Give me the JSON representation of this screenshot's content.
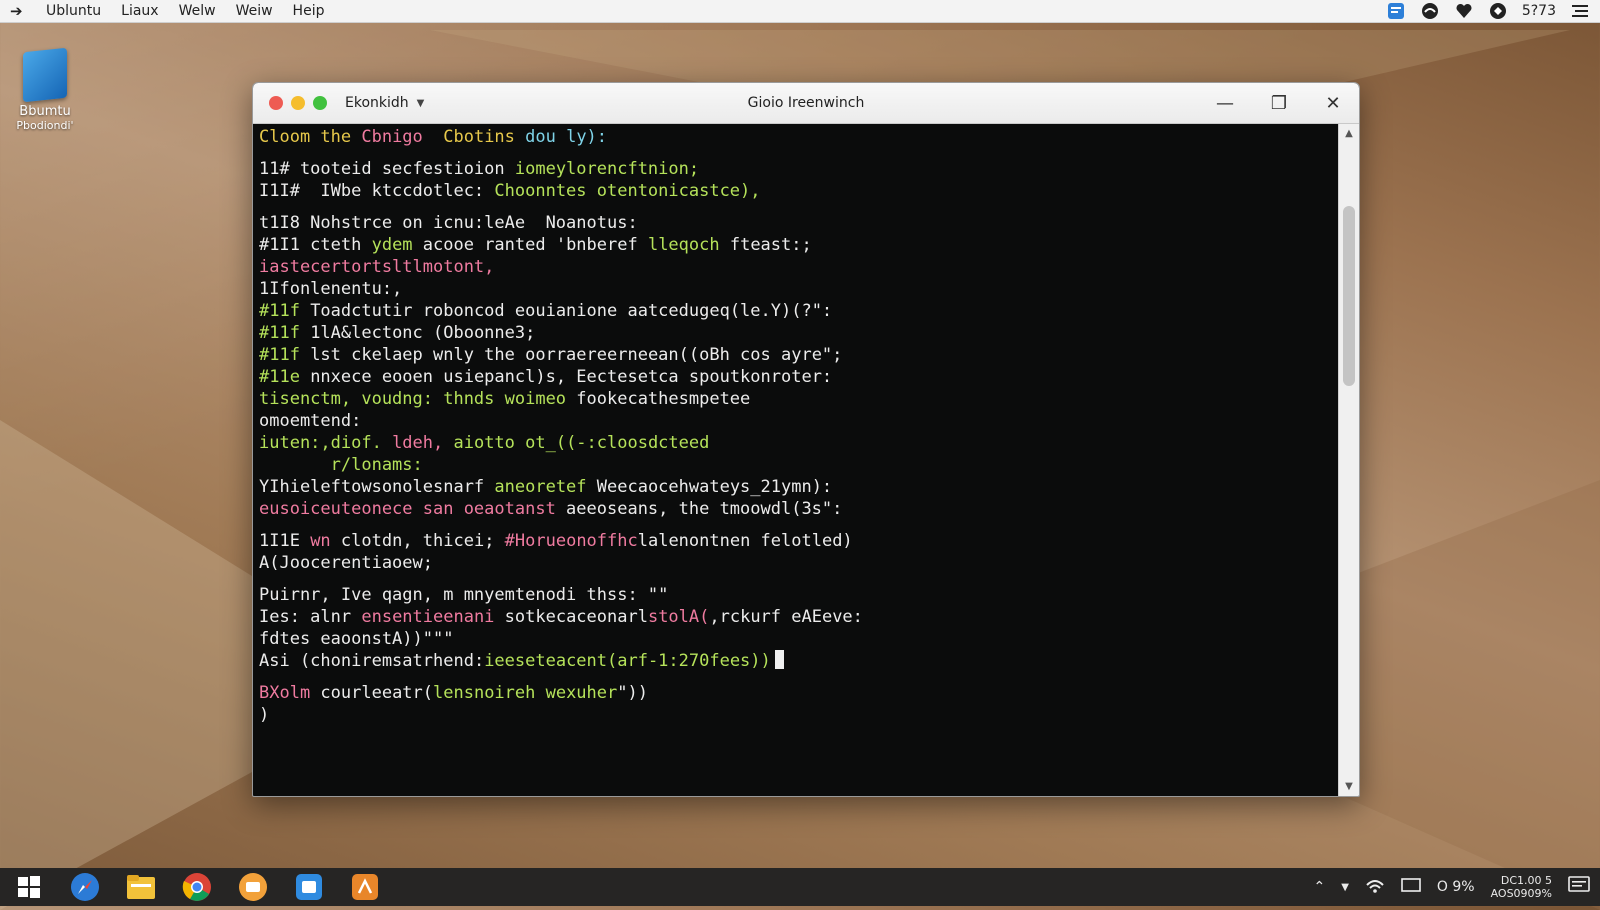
{
  "menubar": {
    "items": [
      "Ubluntu",
      "Liaux",
      "Welw",
      "Weiw",
      "Heip"
    ],
    "status": "5?73"
  },
  "desktop": {
    "icon_label": "Bbumtu",
    "icon_sublabel": "Pbodiondi'"
  },
  "window": {
    "tab_label": "Ekonkidh",
    "title": "Gioio Ireenwinch"
  },
  "terminal": {
    "lines": [
      [
        [
          "Cloom the ",
          "c-yellow"
        ],
        [
          "Cbnigo",
          "c-pink"
        ],
        [
          "  Cbotins",
          "c-yellow"
        ],
        [
          " dou ly):",
          "c-cyan"
        ]
      ],
      [],
      [
        [
          "11# tooteid secfestioion ",
          "c-white"
        ],
        [
          "iomeylorencftnion;",
          "c-green"
        ]
      ],
      [
        [
          "I1I#  IWbe ktccdotlec: ",
          "c-white"
        ],
        [
          "Choonntes otentonicastce),",
          "c-green"
        ]
      ],
      [],
      [
        [
          "t1I8 Nohstrce on icnu:leAe  Noanotus:",
          "c-white"
        ]
      ],
      [
        [
          "#1I1 cteth ",
          "c-white"
        ],
        [
          "ydem",
          "c-green"
        ],
        [
          " acooe ranted 'bnberef ",
          "c-white"
        ],
        [
          "lleqoch",
          "c-green"
        ],
        [
          " fteast:;",
          "c-white"
        ]
      ],
      [
        [
          "iastecertortsltlmotont,",
          "c-pink"
        ]
      ],
      [
        [
          "1Ifonlenentu:,",
          "c-white"
        ]
      ],
      [
        [
          "#11f",
          "c-green"
        ],
        [
          " Toadctutir roboncod eouianione aatcedugeq(le.Y)(?\":",
          "c-white"
        ]
      ],
      [
        [
          "#11f",
          "c-green"
        ],
        [
          " 1lA&lectonc (Oboonne3;",
          "c-white"
        ]
      ],
      [
        [
          "#11f",
          "c-green"
        ],
        [
          " lst ckelaep wnly the oorraereerneean((oBh cos ayre\";",
          "c-white"
        ]
      ],
      [
        [
          "#11e",
          "c-green"
        ],
        [
          " nnxece eooen usiepancl)s, Eectesetca spoutkonroter:",
          "c-white"
        ]
      ],
      [
        [
          "tisenctm, voudng: thnds woimeo",
          "c-green"
        ],
        [
          " fookecathesmpetee",
          "c-white"
        ]
      ],
      [
        [
          "omoemtend:",
          "c-white"
        ]
      ],
      [
        [
          "iuten:,diof. ",
          "c-green"
        ],
        [
          "ldeh,",
          "c-pink"
        ],
        [
          " aiotto ot_((-:cloosdcteed",
          "c-green"
        ]
      ],
      [
        [
          "       r/lonams:",
          "c-green"
        ]
      ],
      [
        [
          "YIhieleftowsonolesnarf ",
          "c-white"
        ],
        [
          "aneoretef",
          "c-green"
        ],
        [
          " Weecaocehwateys_21ymn):",
          "c-white"
        ]
      ],
      [
        [
          "eusoiceuteonece san oeaotanst",
          "c-pink"
        ],
        [
          " aeeoseans, the tmoowdl(3s\":",
          "c-white"
        ]
      ],
      [],
      [
        [
          "1I1E ",
          "c-white"
        ],
        [
          "wn",
          "c-pink"
        ],
        [
          " clotdn, thicei; ",
          "c-white"
        ],
        [
          "#Horueonoffhc",
          "c-pink"
        ],
        [
          "lalenontnen felotled)",
          "c-white"
        ]
      ],
      [
        [
          "A(Joocerentiaoew;",
          "c-white"
        ]
      ],
      [],
      [
        [
          "Puirnr, Ive qagn, m mnyemtenodi thss: \"\"",
          "c-white"
        ]
      ],
      [
        [
          "Ies: alnr ",
          "c-white"
        ],
        [
          "ensentieenani",
          "c-pink"
        ],
        [
          " sotkecaceonarl",
          "c-white"
        ],
        [
          "stolA(",
          "c-pink"
        ],
        [
          ",rckurf eAEeve:",
          "c-white"
        ]
      ],
      [
        [
          "fdtes eaoonstA))\"\"\"",
          "c-white"
        ]
      ],
      [
        [
          "Asi (chonirems",
          "c-white"
        ],
        [
          "atrhend:",
          "c-white"
        ],
        [
          "ieeseteacent(arf-1:270fees))",
          "c-green"
        ],
        [
          "CURSOR",
          "cursor"
        ]
      ],
      [],
      [
        [
          "BXolm ",
          "c-pink"
        ],
        [
          "courleeatr(",
          "c-white"
        ],
        [
          "lensnoireh wexuher",
          "c-green"
        ],
        [
          "\"))",
          "c-white"
        ]
      ],
      [
        [
          ")",
          "c-white"
        ]
      ]
    ]
  },
  "taskbar": {
    "tray_text": "O 9%",
    "clock_line1": "DC1.00 5",
    "clock_line2": "AOS0909%"
  }
}
